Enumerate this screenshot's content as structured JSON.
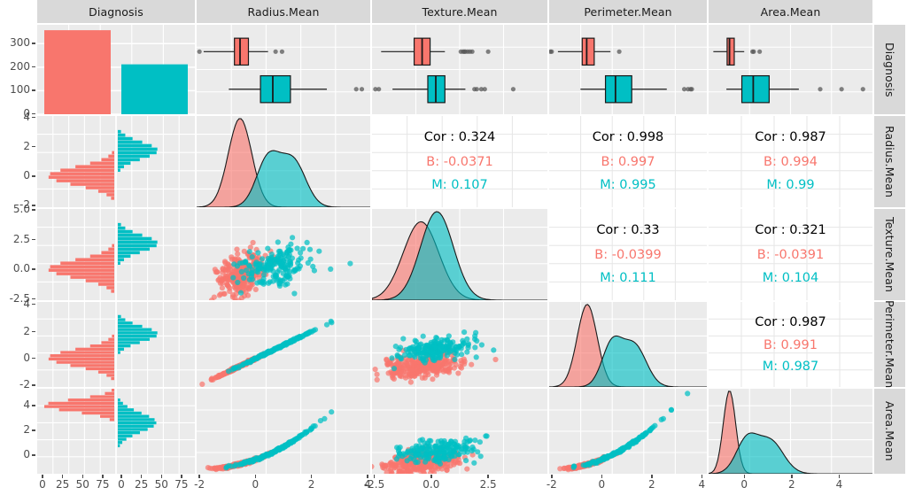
{
  "plot": {
    "type": "scatterplot-matrix",
    "library": "ggpairs",
    "variables": [
      "Diagnosis",
      "Radius.Mean",
      "Texture.Mean",
      "Perimeter.Mean",
      "Area.Mean"
    ],
    "group_colors": {
      "B": "#f8766d",
      "M": "#00bfc4"
    },
    "panel_bg": "#ebebeb",
    "grid_color": "#ffffff",
    "strip_bg": "#d9d9d9"
  },
  "col_titles": [
    "Diagnosis",
    "Radius.Mean",
    "Texture.Mean",
    "Perimeter.Mean",
    "Area.Mean"
  ],
  "row_titles": [
    "Diagnosis",
    "Radius.Mean",
    "Texture.Mean",
    "Perimeter.Mean",
    "Area.Mean"
  ],
  "chart_data": {
    "type": "scatter",
    "title": "",
    "xlabel": "",
    "ylabel": "",
    "grid": true,
    "legend_position": "none",
    "groups": [
      {
        "name": "B",
        "color": "#f8766d",
        "count": 357
      },
      {
        "name": "M",
        "color": "#00bfc4",
        "count": 212
      }
    ],
    "bar_chart": {
      "type": "bar",
      "title": "Diagnosis",
      "categories": [
        "B",
        "M"
      ],
      "values": [
        357,
        212
      ],
      "ylim": [
        0,
        380
      ],
      "yticks": [
        0,
        100,
        200,
        300
      ],
      "ylabel": "",
      "xlabel": ""
    },
    "axes": [
      {
        "var": "Diagnosis",
        "ticks_x": [
          "0",
          "25",
          "50",
          "75",
          "0",
          "25",
          "50",
          "75"
        ],
        "ticks_y": [
          "0",
          "100",
          "200",
          "300"
        ]
      },
      {
        "var": "Radius.Mean",
        "ticks_x": [
          "-2",
          "0",
          "2",
          "4"
        ],
        "ticks_y": [
          "-2",
          "0",
          "2",
          "4"
        ],
        "range": [
          -2.1,
          4.1
        ]
      },
      {
        "var": "Texture.Mean",
        "ticks_x": [
          "-2.5",
          "0.0",
          "2.5"
        ],
        "ticks_y": [
          "-2.5",
          "0.0",
          "2.5",
          "5.0"
        ],
        "range": [
          -2.6,
          5.1
        ]
      },
      {
        "var": "Perimeter.Mean",
        "ticks_x": [
          "-2",
          "0",
          "2",
          "4"
        ],
        "ticks_y": [
          "-2",
          "0",
          "2",
          "4"
        ],
        "range": [
          -2.1,
          4.2
        ]
      },
      {
        "var": "Area.Mean",
        "ticks_x": [
          "0",
          "2",
          "4"
        ],
        "ticks_y": [
          "0",
          "2",
          "4"
        ],
        "range": [
          -1.5,
          5.4
        ]
      }
    ],
    "correlations": [
      {
        "row": "Radius.Mean",
        "col": "Texture.Mean",
        "all": "Cor : 0.324",
        "B": "B: -0.0371",
        "M": "M: 0.107"
      },
      {
        "row": "Radius.Mean",
        "col": "Perimeter.Mean",
        "all": "Cor : 0.998",
        "B": "B: 0.997",
        "M": "M: 0.995"
      },
      {
        "row": "Radius.Mean",
        "col": "Area.Mean",
        "all": "Cor : 0.987",
        "B": "B: 0.994",
        "M": "M: 0.99"
      },
      {
        "row": "Texture.Mean",
        "col": "Perimeter.Mean",
        "all": "Cor : 0.33",
        "B": "B: -0.0399",
        "M": "M: 0.111"
      },
      {
        "row": "Texture.Mean",
        "col": "Area.Mean",
        "all": "Cor : 0.321",
        "B": "B: -0.0391",
        "M": "M: 0.104"
      },
      {
        "row": "Perimeter.Mean",
        "col": "Area.Mean",
        "all": "Cor : 0.987",
        "B": "B: 0.991",
        "M": "M: 0.987"
      }
    ],
    "boxplots": [
      {
        "var": "Radius.Mean",
        "B": {
          "min": -1.85,
          "q1": -0.75,
          "med": -0.55,
          "q3": -0.25,
          "max": 0.45,
          "outliers": [
            -2.0,
            0.72,
            0.95
          ]
        },
        "M": {
          "min": -0.95,
          "q1": 0.18,
          "med": 0.62,
          "q3": 1.25,
          "max": 2.55,
          "outliers": [
            3.6,
            3.8
          ]
        }
      },
      {
        "var": "Texture.Mean",
        "B": {
          "min": -2.2,
          "q1": -0.75,
          "med": -0.4,
          "q3": -0.05,
          "max": 0.6,
          "outliers": [
            1.3,
            1.4,
            1.45,
            1.5,
            1.6,
            1.7,
            1.8,
            2.5
          ]
        },
        "M": {
          "min": -1.7,
          "q1": -0.15,
          "med": 0.2,
          "q3": 0.6,
          "max": 1.5,
          "outliers": [
            -2.45,
            -2.3,
            1.9,
            2.0,
            2.2,
            2.35,
            3.6
          ]
        }
      },
      {
        "var": "Perimeter.Mean",
        "B": {
          "min": -1.75,
          "q1": -0.78,
          "med": -0.6,
          "q3": -0.3,
          "max": 0.35,
          "outliers": [
            -2.05,
            -2.0,
            0.7
          ]
        },
        "M": {
          "min": -0.85,
          "q1": 0.15,
          "med": 0.55,
          "q3": 1.2,
          "max": 2.6,
          "outliers": [
            3.3,
            3.45,
            3.55,
            3.6
          ]
        }
      },
      {
        "var": "Area.Mean",
        "B": {
          "min": -1.3,
          "q1": -0.72,
          "med": -0.62,
          "q3": -0.42,
          "max": 0.0,
          "outliers": [
            0.35,
            0.4,
            0.65
          ]
        },
        "M": {
          "min": -0.75,
          "q1": -0.1,
          "med": 0.38,
          "q3": 1.05,
          "max": 2.3,
          "outliers": [
            3.2,
            4.1,
            5.0
          ]
        }
      }
    ]
  }
}
